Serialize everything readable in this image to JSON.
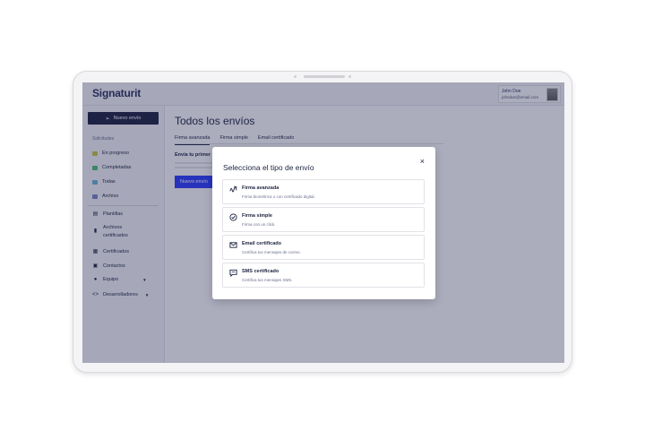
{
  "app": {
    "logo": "Signaturit"
  },
  "user": {
    "name": "John Doe",
    "email": "johndoe@email.com"
  },
  "sidebar": {
    "new_button": "Nuevo envío",
    "section_title": "Solicitudes",
    "status_items": [
      {
        "label": "En progreso",
        "color": "#c9c94a"
      },
      {
        "label": "Completadas",
        "color": "#4cc07a"
      },
      {
        "label": "Todas",
        "color": "#6fb4d6"
      },
      {
        "label": "Archivo",
        "color": "#7a86c4"
      }
    ],
    "menu_items": [
      {
        "label": "Plantillas",
        "icon": "template-icon"
      },
      {
        "label": "Archivos certificados",
        "icon": "file-icon"
      },
      {
        "label": "Certificados",
        "icon": "certificate-icon"
      },
      {
        "label": "Contactos",
        "icon": "contacts-icon"
      },
      {
        "label": "Equipo",
        "icon": "team-icon"
      },
      {
        "label": "Desarrolladores",
        "icon": "code-icon"
      }
    ]
  },
  "main": {
    "title": "Todos los envíos",
    "tabs": [
      "Firma avanzada",
      "Firma simple",
      "Email certificado"
    ],
    "send_first": "Envía tu primer",
    "button_label": "Nuevo envío"
  },
  "modal": {
    "title": "Selecciona el tipo de envío",
    "close": "×",
    "options": [
      {
        "title": "Firma avanzada",
        "desc": "Firma biométrica o con certificado digital.",
        "icon": "signature-icon"
      },
      {
        "title": "Firma simple",
        "desc": "Firma con un click.",
        "icon": "check-circle-icon"
      },
      {
        "title": "Email certificado",
        "desc": "Certifica tus mensajes de correo.",
        "icon": "mail-icon"
      },
      {
        "title": "SMS certificado",
        "desc": "Certifica tus mensajes SMS.",
        "icon": "chat-icon"
      }
    ]
  }
}
